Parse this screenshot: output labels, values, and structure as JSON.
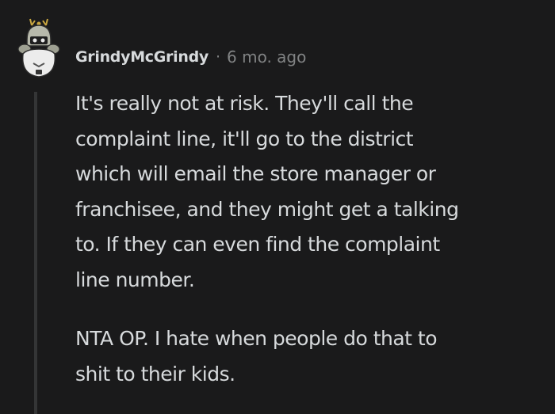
{
  "comment": {
    "author": "GrindyMcGrindy",
    "separator": "·",
    "timestamp": "6 mo. ago",
    "paragraphs": [
      "It's really not at risk. They'll call the\ncomplaint line, it'll go to the district\nwhich will email the store manager or\nfranchisee, and they might get a talking\nto. If they can even find the complaint\nline number.",
      "NTA OP. I hate when people do that to\nshit to their kids."
    ]
  },
  "colors": {
    "background": "#1a1a1b",
    "text": "#d7dadc",
    "meta_text": "#818384",
    "thread_line": "#343536"
  }
}
